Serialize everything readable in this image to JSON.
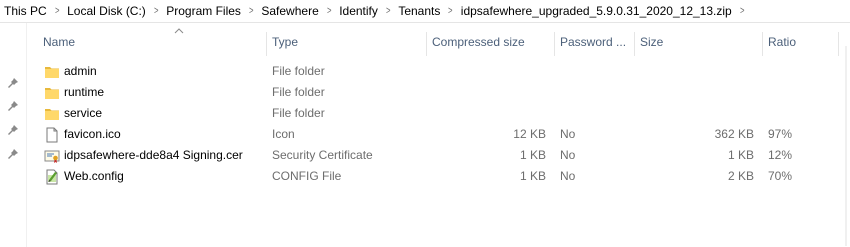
{
  "breadcrumb": [
    "This PC",
    "Local Disk (C:)",
    "Program Files",
    "Safewhere",
    "Identify",
    "Tenants",
    "idpsafewhere_upgraded_5.9.0.31_2020_12_13.zip"
  ],
  "columns": {
    "name": "Name",
    "type": "Type",
    "compressed_size": "Compressed size",
    "password": "Password ...",
    "size": "Size",
    "ratio": "Ratio"
  },
  "files": [
    {
      "name": "admin",
      "type": "File folder",
      "compressed_size": "",
      "password": "",
      "size": "",
      "ratio": "",
      "icon": "folder-icon"
    },
    {
      "name": "runtime",
      "type": "File folder",
      "compressed_size": "",
      "password": "",
      "size": "",
      "ratio": "",
      "icon": "folder-icon"
    },
    {
      "name": "service",
      "type": "File folder",
      "compressed_size": "",
      "password": "",
      "size": "",
      "ratio": "",
      "icon": "folder-icon"
    },
    {
      "name": "favicon.ico",
      "type": "Icon",
      "compressed_size": "12 KB",
      "password": "No",
      "size": "362 KB",
      "ratio": "97%",
      "icon": "file-icon"
    },
    {
      "name": "idpsafewhere-dde8a4 Signing.cer",
      "type": "Security Certificate",
      "compressed_size": "1 KB",
      "password": "No",
      "size": "1 KB",
      "ratio": "12%",
      "icon": "certificate-icon"
    },
    {
      "name": "Web.config",
      "type": "CONFIG File",
      "compressed_size": "1 KB",
      "password": "No",
      "size": "2 KB",
      "ratio": "70%",
      "icon": "config-file-icon"
    }
  ],
  "colors": {
    "header_text": "#4c607a",
    "folder": "#ffd869",
    "secondary_text": "#6d6d6d"
  }
}
